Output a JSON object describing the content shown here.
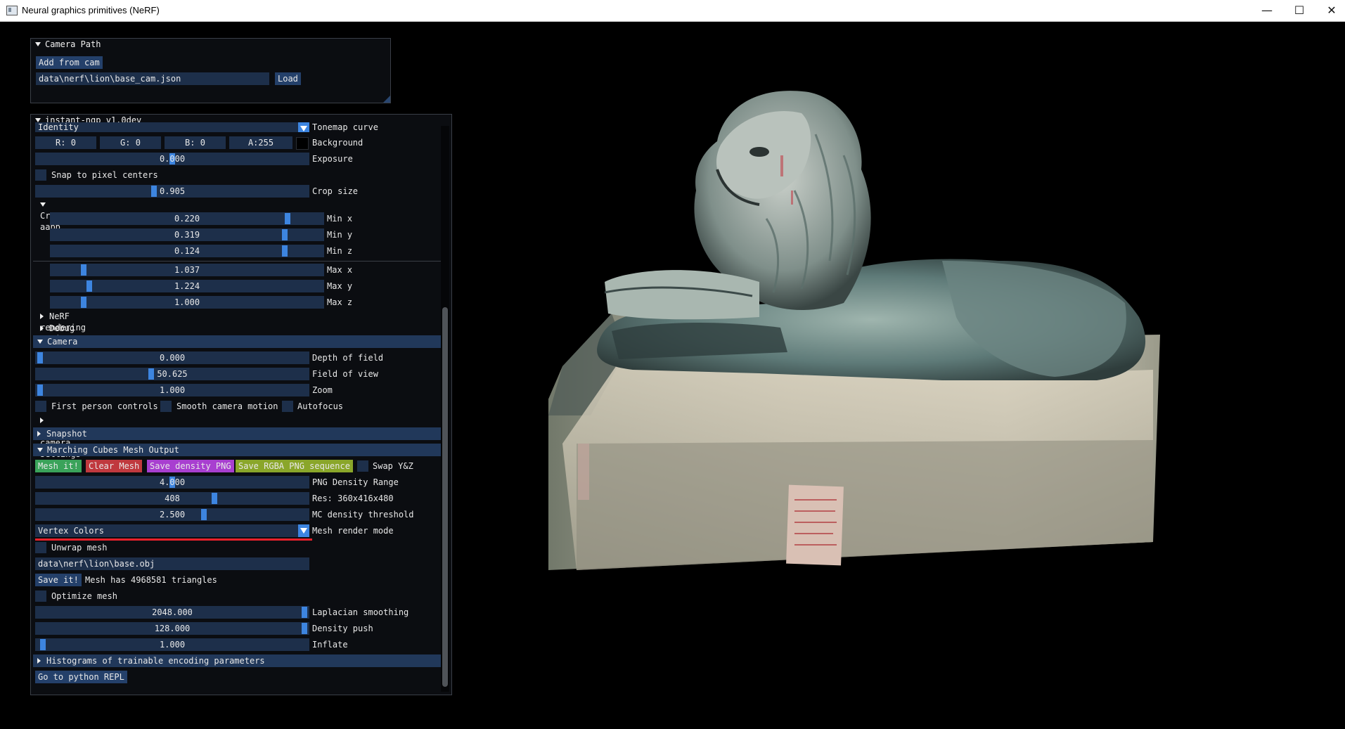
{
  "window": {
    "title": "Neural graphics primitives (NeRF)"
  },
  "camera_path": {
    "header": "Camera Path",
    "add_button": "Add from cam",
    "path_value": "data\\nerf\\lion\\base_cam.json",
    "load_button": "Load"
  },
  "panel": {
    "header": "instant-ngp v1.0dev",
    "tonemap": {
      "value": "Identity",
      "label": "Tonemap curve"
    },
    "background": {
      "r": "R:  0",
      "g": "G:  0",
      "b": "B:  0",
      "a": "A:255",
      "label": "Background"
    },
    "exposure": {
      "value": "0.000",
      "label": "Exposure",
      "fraction": 0.5
    },
    "snap": {
      "label": "Snap to pixel centers"
    },
    "crop_size": {
      "value": "0.905",
      "label": "Crop size",
      "fraction": 0.43
    },
    "crop_aabb": {
      "label": "Crop aabb",
      "min": [
        {
          "value": "0.220",
          "label": "Min x",
          "fraction": 0.88
        },
        {
          "value": "0.319",
          "label": "Min y",
          "fraction": 0.87
        },
        {
          "value": "0.124",
          "label": "Min z",
          "fraction": 0.87
        }
      ],
      "max": [
        {
          "value": "1.037",
          "label": "Max x",
          "fraction": 0.11
        },
        {
          "value": "1.224",
          "label": "Max y",
          "fraction": 0.13
        },
        {
          "value": "1.000",
          "label": "Max z",
          "fraction": 0.11
        }
      ]
    },
    "nerf_options": "NeRF rendering options",
    "debug_vis": "Debug visualization",
    "camera": {
      "header": "Camera",
      "dof": {
        "value": "0.000",
        "label": "Depth of field",
        "fraction": 0.0
      },
      "fov": {
        "value": "50.625",
        "label": "Field of view",
        "fraction": 0.42
      },
      "zoom": {
        "value": "1.000",
        "label": "Zoom",
        "fraction": 0.0
      },
      "first_person": "First person controls",
      "smooth": "Smooth camera motion",
      "autofocus": "Autofocus",
      "advanced": "Advanced camera settings"
    },
    "snapshot": "Snapshot",
    "mc": {
      "header": "Marching Cubes Mesh Output",
      "mesh_it": "Mesh it!",
      "clear_mesh": "Clear Mesh",
      "save_density": "Save density PNG",
      "save_rgba": "Save RGBA PNG sequence",
      "swap": "Swap Y&Z",
      "png_density": {
        "value": "4.000",
        "label": "PNG Density Range",
        "fraction": 0.5
      },
      "res": {
        "value": "408",
        "label": "Res: 360x416x480",
        "fraction": 0.66
      },
      "mc_threshold": {
        "value": "2.500",
        "label": "MC density threshold",
        "fraction": 0.62
      },
      "render_mode": {
        "value": "Vertex Colors",
        "label": "Mesh render mode"
      },
      "unwrap": "Unwrap mesh",
      "obj_path": "data\\nerf\\lion\\base.obj",
      "save_it": "Save it!",
      "mesh_info": "Mesh has 4968581 triangles",
      "optimize": "Optimize mesh",
      "laplacian": {
        "value": "2048.000",
        "label": "Laplacian smoothing",
        "fraction": 1.0
      },
      "density_push": {
        "value": "128.000",
        "label": "Density push",
        "fraction": 1.0
      },
      "inflate": {
        "value": "1.000",
        "label": "Inflate",
        "fraction": 0.01
      }
    },
    "histograms": "Histograms of trainable encoding parameters",
    "python_repl": "Go to python REPL"
  },
  "colors": {
    "mesh_it": "#3aa35a",
    "clear_mesh": "#c0393e",
    "save_density": "#a83fd0",
    "save_rgba": "#8aa62a",
    "underline": "#e8212b"
  }
}
